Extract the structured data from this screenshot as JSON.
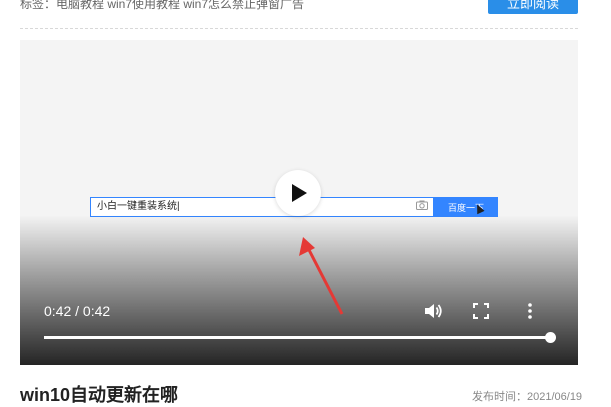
{
  "header": {
    "tags_text": "标签：电脑教程  win7使用教程  win7怎么禁止弹窗广告",
    "read_now_label": "立即阅读"
  },
  "video": {
    "frame": {
      "search_value": "小白一键重装系统|",
      "search_button_label": "百度一下"
    },
    "time_display": "0:42 / 0:42",
    "progress_fraction": 1.0,
    "icons": [
      "play-icon",
      "volume-icon",
      "fullscreen-icon",
      "more-icon",
      "camera-icon"
    ]
  },
  "article": {
    "title": "win10自动更新在哪",
    "publish_time": "发布时间：2021/06/19"
  }
}
